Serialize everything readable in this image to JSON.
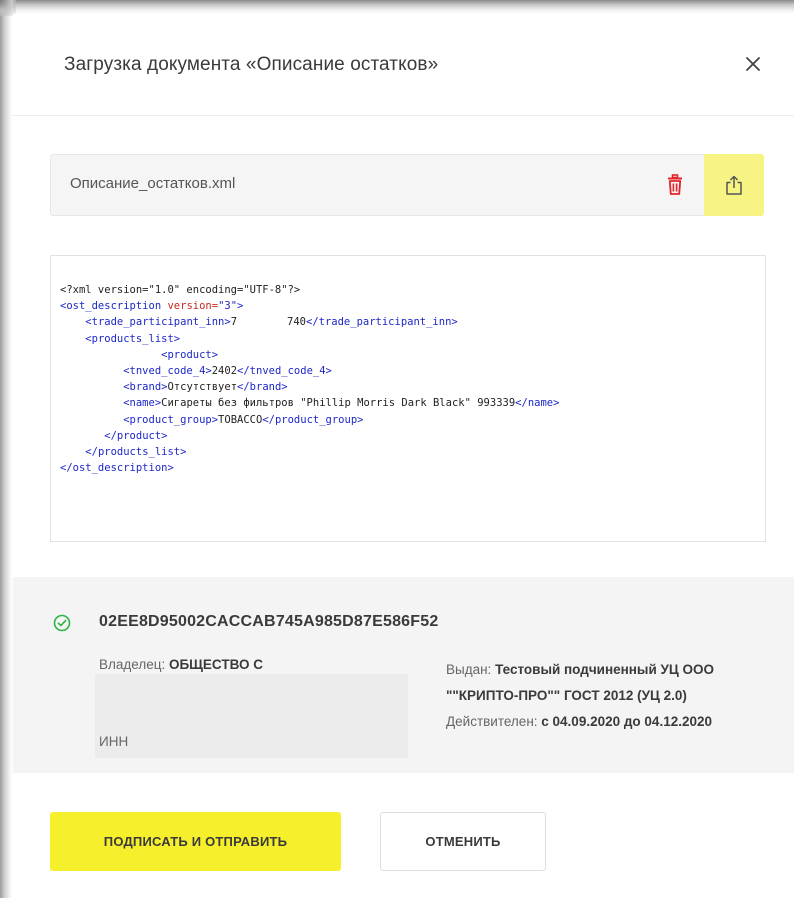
{
  "dialog": {
    "title": "Загрузка документа «Описание остатков»",
    "close_icon": "close-icon"
  },
  "file": {
    "name": "Описание_остатков.xml",
    "delete_icon": "trash-icon",
    "upload_icon": "upload-icon",
    "accent_color": "#f7f484",
    "delete_color": "#e3242b"
  },
  "xml": {
    "decl": "<?xml version=\"1.0\" encoding=\"UTF-8\"?>",
    "root_open": "<ost_description",
    "root_attr": "version=",
    "root_attr_value": "\"3\"",
    "root_open_end": ">",
    "inn_open": "<trade_participant_inn>",
    "inn_value_start": "7",
    "inn_value_end": "740",
    "inn_close": "</trade_participant_inn>",
    "list_open": "<products_list>",
    "product_open": "<product>",
    "tnved_open": "<tnved_code_4>",
    "tnved_value": "2402",
    "tnved_close": "</tnved_code_4>",
    "brand_open": "<brand>",
    "brand_value": "Отсутствует",
    "brand_close": "</brand>",
    "name_open": "<name>",
    "name_value": "Сигареты без фильтров \"Phillip Morris Dark Black\" 993339",
    "name_close": "</name>",
    "group_open": "<product_group>",
    "group_value": "TOBACCO",
    "group_close": "</product_group>",
    "product_close": "</product>",
    "list_close": "</products_list>",
    "root_close": "</ost_description>",
    "tag_color": "#1e27c9",
    "attr_color": "#c7281e"
  },
  "certificate": {
    "status_icon": "check-circle-icon",
    "status_color": "#2fb344",
    "id": "02EE8D95002CACCAB745A985D87E586F52",
    "owner_label": "Владелец: ",
    "owner_value": "ОБЩЕСТВО С",
    "inn_label": "ИНН",
    "issuer_label": "Выдан: ",
    "issuer_value_line1": "Тестовый подчиненный УЦ ООО",
    "issuer_value_line2": "\"\"КРИПТО-ПРО\"\" ГОСТ 2012 (УЦ 2.0)",
    "valid_label": "Действителен: ",
    "valid_value": "с 04.09.2020 до 04.12.2020"
  },
  "actions": {
    "sign_label": "ПОДПИСАТЬ И ОТПРАВИТЬ",
    "sign_color": "#f6ef2b",
    "cancel_label": "ОТМЕНИТЬ"
  }
}
